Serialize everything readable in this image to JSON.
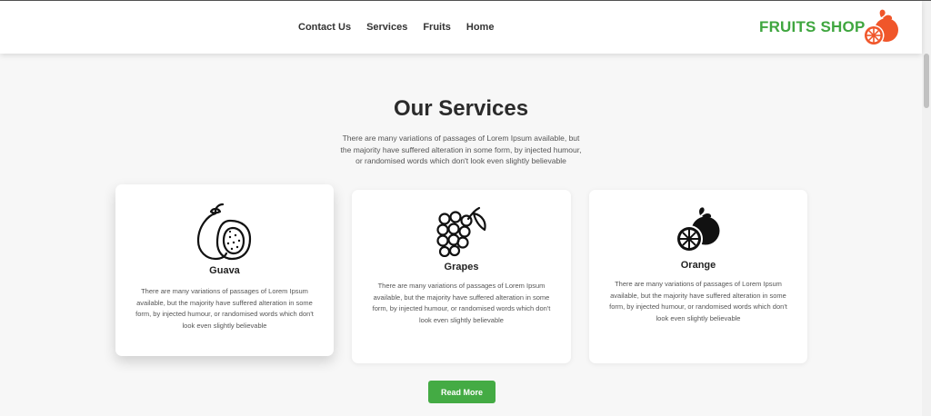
{
  "nav": {
    "items": [
      "Contact Us",
      "Services",
      "Fruits",
      "Home"
    ]
  },
  "brand": {
    "name": "FRUITS SHOP",
    "icon": "orange-logo-icon",
    "color": "#3fa63f",
    "accent": "#f0562a"
  },
  "section": {
    "title": "Our Services",
    "description": "There are many variations of passages of Lorem Ipsum available, but the majority have suffered alteration in some form, by injected humour, or randomised words which don't look even slightly believable"
  },
  "cards": [
    {
      "title": "Guava",
      "icon": "guava-icon",
      "text": "There are many variations of passages of Lorem Ipsum available, but the majority have suffered alteration in some form, by injected humour, or randomised words which don't look even slightly believable"
    },
    {
      "title": "Grapes",
      "icon": "grapes-icon",
      "text": "There are many variations of passages of Lorem Ipsum available, but the majority have suffered alteration in some form, by injected humour, or randomised words which don't look even slightly believable"
    },
    {
      "title": "Orange",
      "icon": "orange-icon",
      "text": "There are many variations of passages of Lorem Ipsum available, but the majority have suffered alteration in some form, by injected humour, or randomised words which don't look even slightly believable"
    }
  ],
  "cta": {
    "label": "Read More",
    "color": "#44ab44"
  }
}
